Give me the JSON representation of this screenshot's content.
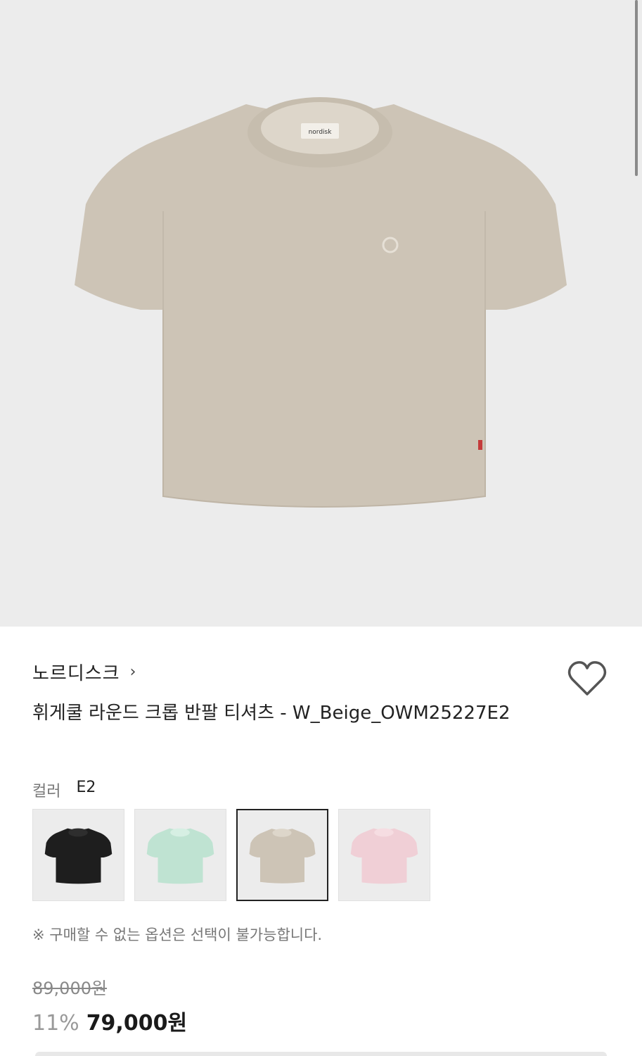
{
  "product": {
    "brand": "노르디스크",
    "brand_chevron": "›",
    "title": "휘게쿨 라운드 크롭 반팔 티셔츠 - W_Beige_OWM25227E2",
    "label_text": "nordisk"
  },
  "color_option": {
    "label": "컬러",
    "selected_value": "E2",
    "swatches": [
      {
        "name": "black",
        "color": "#1e1e1e"
      },
      {
        "name": "mint",
        "color": "#bfe3d2"
      },
      {
        "name": "beige",
        "color": "#cdc4b6",
        "selected": true
      },
      {
        "name": "pink",
        "color": "#f0cfd6"
      }
    ]
  },
  "notice": "※ 구매할 수 없는 옵션은 선택이 불가능합니다.",
  "pricing": {
    "original_price": "89,000원",
    "discount_rate": "11%",
    "sale_price": "79,000원"
  },
  "colors": {
    "hero_background": "#ececec",
    "shirt_main": "#cdc4b6"
  }
}
